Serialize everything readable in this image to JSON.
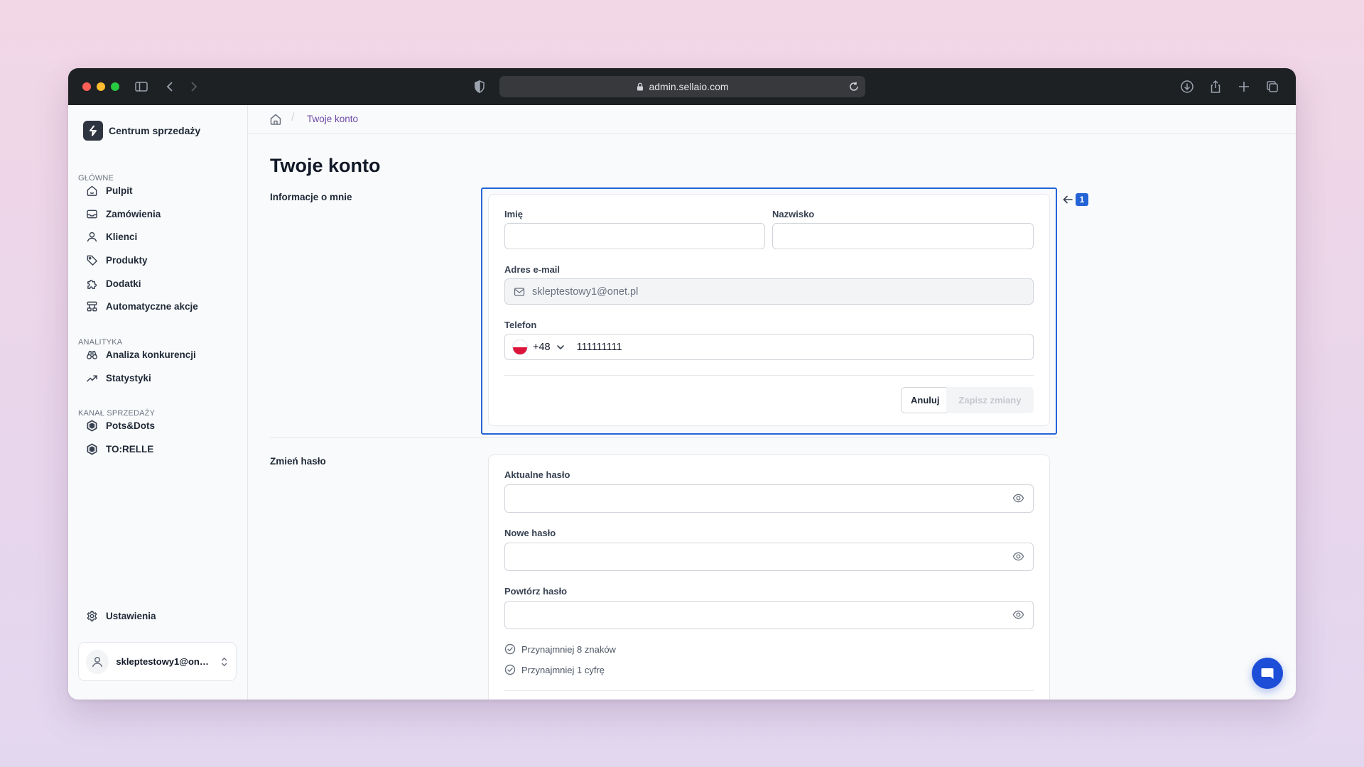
{
  "browser": {
    "url": "admin.sellaio.com",
    "traffic_colors": [
      "#ff5f57",
      "#febc2e",
      "#28c840"
    ]
  },
  "sidebar": {
    "brand": "Centrum sprzedaży",
    "sections": [
      {
        "label": "GŁÓWNE",
        "items": [
          {
            "label": "Pulpit",
            "icon": "home-icon"
          },
          {
            "label": "Zamówienia",
            "icon": "inbox-icon"
          },
          {
            "label": "Klienci",
            "icon": "user-icon"
          },
          {
            "label": "Produkty",
            "icon": "tag-icon"
          },
          {
            "label": "Dodatki",
            "icon": "puzzle-icon"
          },
          {
            "label": "Automatyczne akcje",
            "icon": "workflow-icon"
          }
        ]
      },
      {
        "label": "ANALITYKA",
        "items": [
          {
            "label": "Analiza konkurencji",
            "icon": "binoculars-icon"
          },
          {
            "label": "Statystyki",
            "icon": "trending-up-icon"
          }
        ]
      },
      {
        "label": "KANAŁ SPRZEDAŻY",
        "items": [
          {
            "label": "Pots&Dots",
            "icon": "store-hex-icon"
          },
          {
            "label": "TO:RELLE",
            "icon": "store-hex-icon"
          }
        ]
      }
    ],
    "settings_label": "Ustawienia",
    "user_email": "skleptestowy1@onet.pl"
  },
  "breadcrumb": {
    "current": "Twoje konto"
  },
  "page": {
    "title": "Twoje konto",
    "info_section": {
      "title": "Informacje o mnie",
      "first_name_label": "Imię",
      "first_name_value": "",
      "last_name_label": "Nazwisko",
      "last_name_value": "",
      "email_label": "Adres e-mail",
      "email_value": "skleptestowy1@onet.pl",
      "phone_label": "Telefon",
      "phone_code": "+48",
      "phone_value": "111111111",
      "cancel_label": "Anuluj",
      "save_label": "Zapisz zmiany"
    },
    "password_section": {
      "title": "Zmień hasło",
      "current_label": "Aktualne hasło",
      "new_label": "Nowe hasło",
      "repeat_label": "Powtórz hasło",
      "requirements": [
        "Przynajmniej 8 znaków",
        "Przynajmniej 1 cyfrę"
      ]
    }
  },
  "annotation": {
    "marker_number": "1",
    "color": "#2463d6"
  }
}
